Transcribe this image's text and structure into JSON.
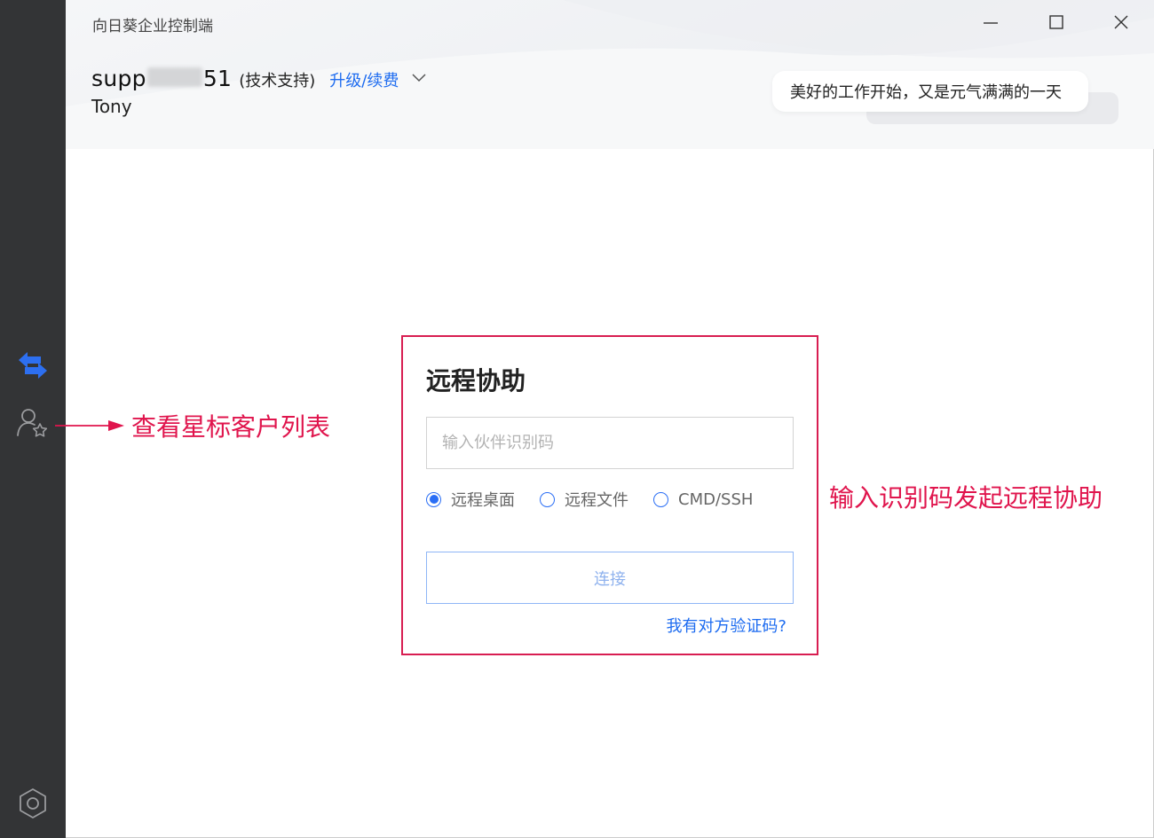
{
  "app": {
    "title": "向日葵企业控制端"
  },
  "window_controls": {
    "minimize": "minimize-icon",
    "maximize": "maximize-icon",
    "close": "close-icon"
  },
  "user": {
    "account_prefix": "supp",
    "account_suffix": "51",
    "role": "(技术支持)",
    "upgrade_link": "升级/续费",
    "nickname": "Tony"
  },
  "greeting": "美好的工作开始，又是元气满满的一天",
  "sidebar": {
    "items": [
      {
        "icon": "remote-control-icon",
        "active": true
      },
      {
        "icon": "starred-customers-icon",
        "active": false
      },
      {
        "icon": "settings-icon",
        "active": false
      }
    ]
  },
  "remote_assist": {
    "title": "远程协助",
    "input_placeholder": "输入伙伴识别码",
    "input_value": "",
    "modes": [
      {
        "label": "远程桌面",
        "checked": true
      },
      {
        "label": "远程文件",
        "checked": false
      },
      {
        "label": "CMD/SSH",
        "checked": false
      }
    ],
    "connect_label": "连接",
    "verify_link": "我有对方验证码?"
  },
  "annotations": {
    "left": "查看星标客户列表",
    "right": "输入识别码发起远程协助"
  },
  "colors": {
    "sidebar_bg": "#333436",
    "accent": "#1e6cf0",
    "annotation": "#e0154d"
  }
}
